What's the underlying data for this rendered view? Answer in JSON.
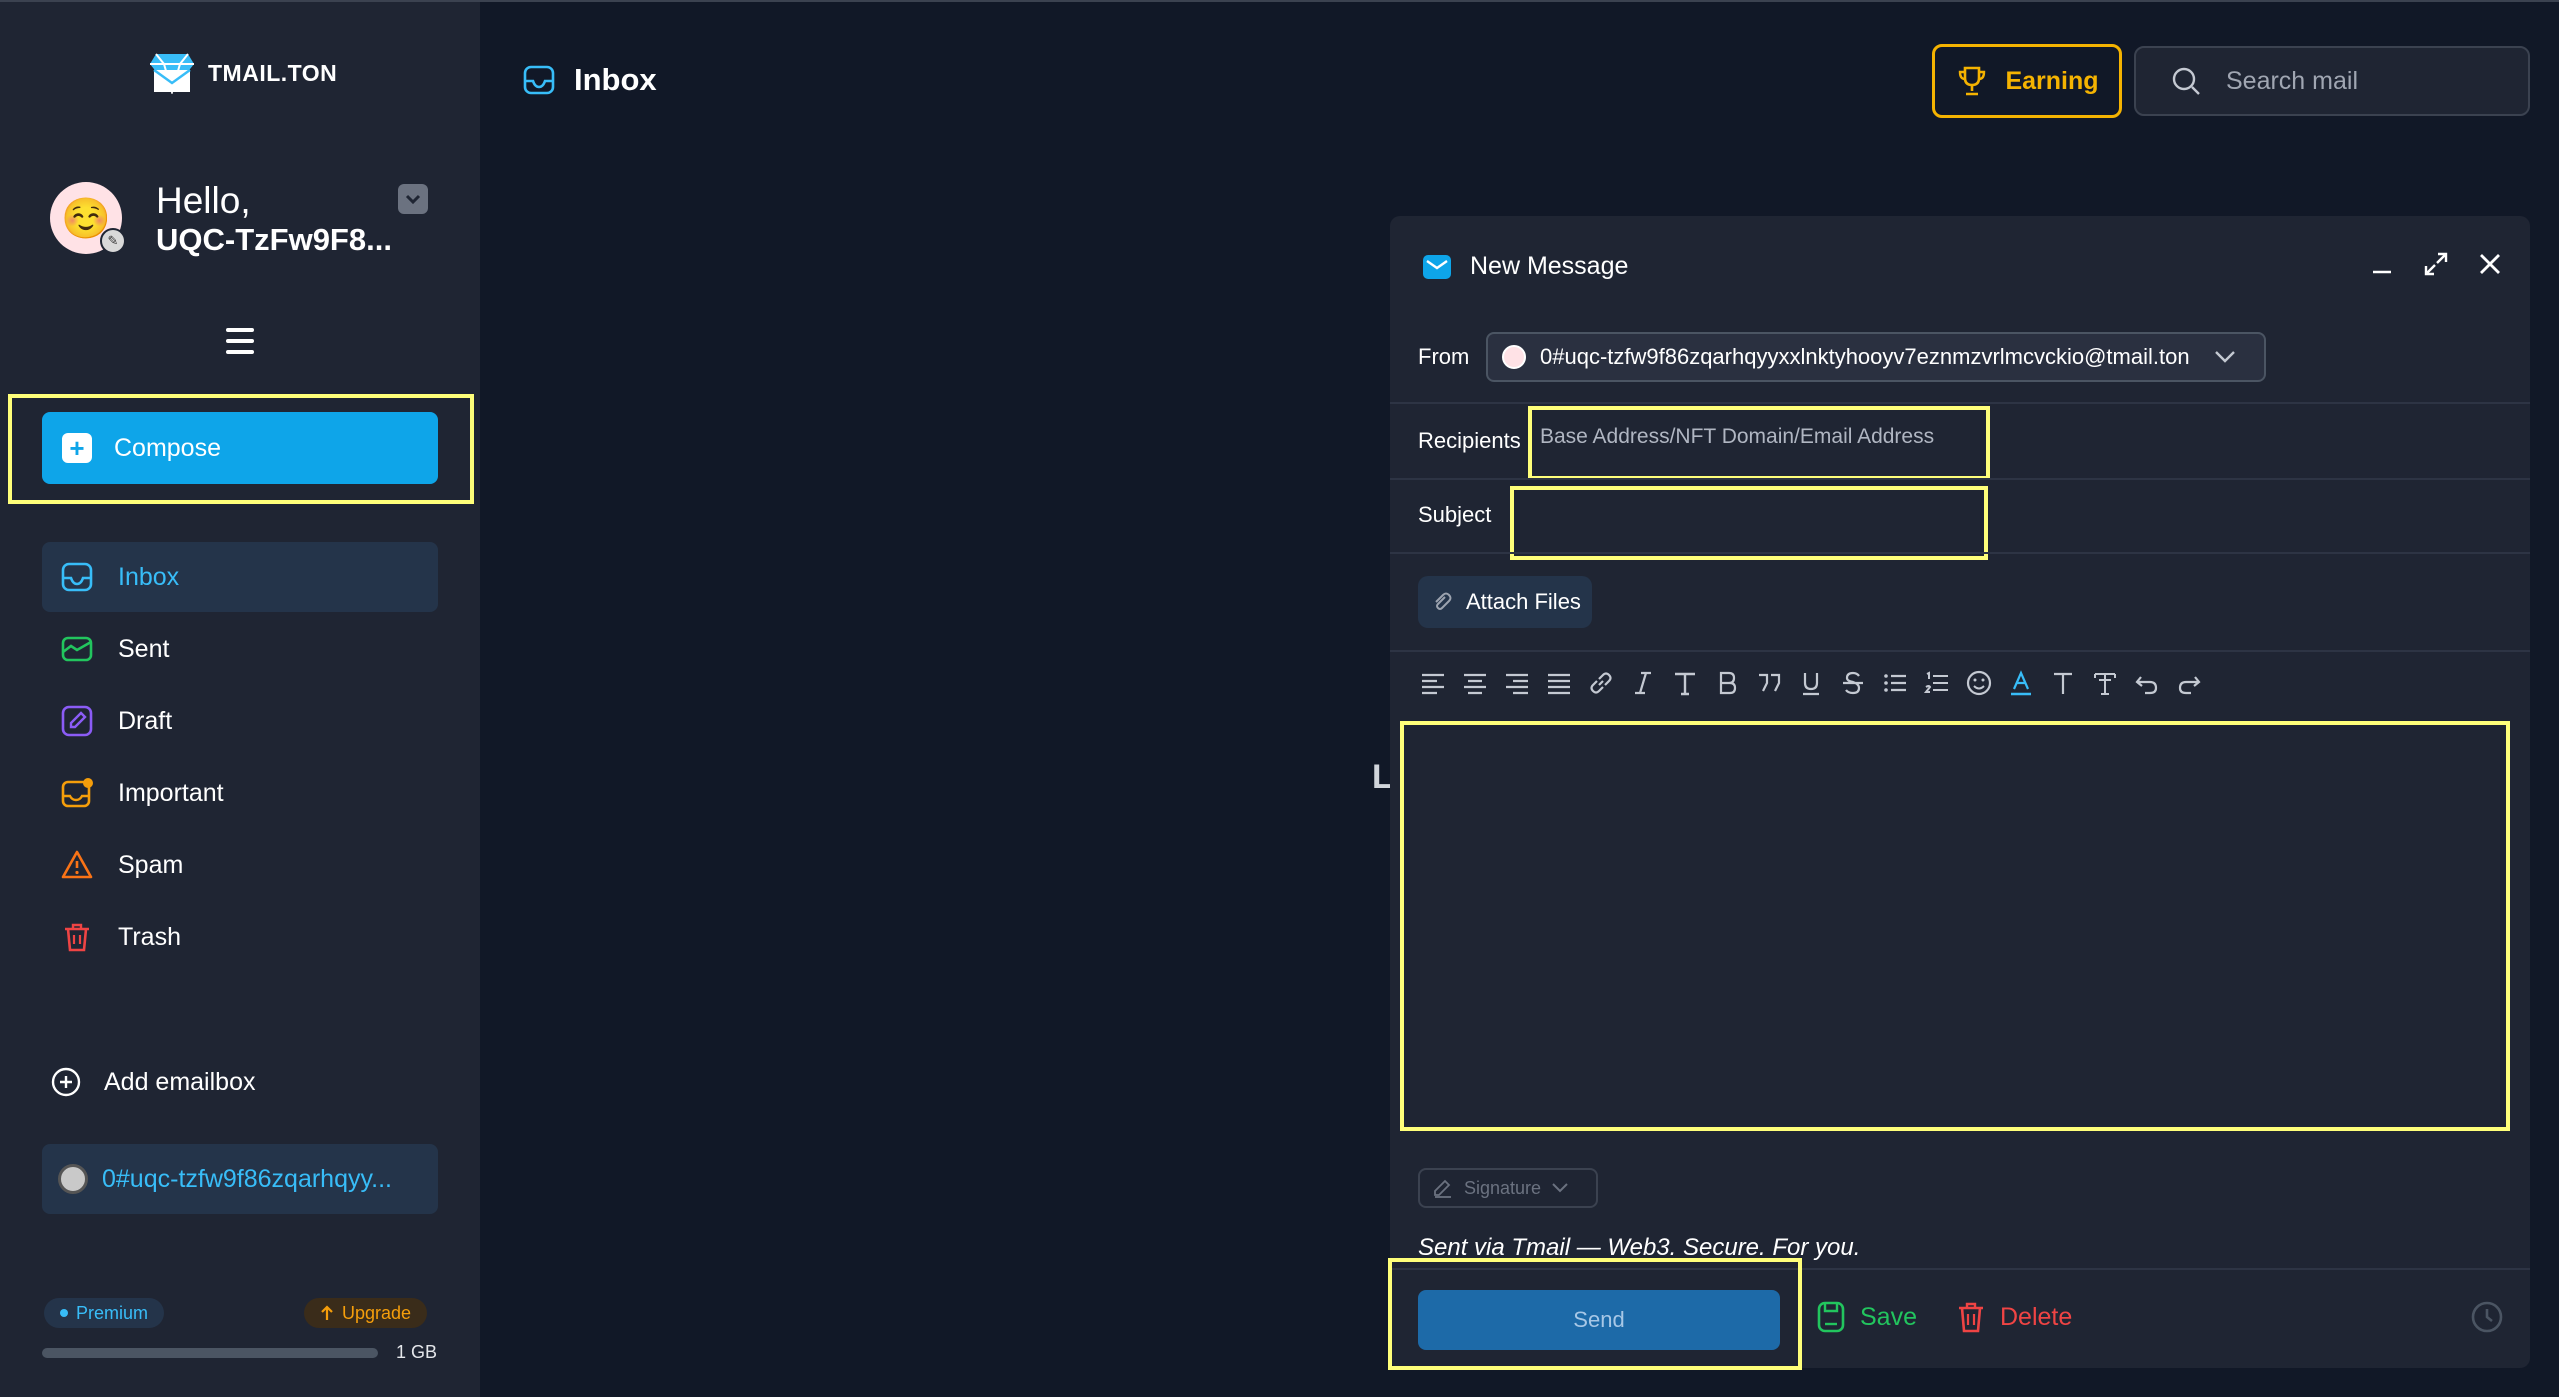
{
  "app": {
    "logo_text": "TMAIL.TON"
  },
  "user": {
    "greeting": "Hello,",
    "username": "UQC-TzFw9F8...",
    "avatar_emoji": "☺️"
  },
  "sidebar": {
    "compose_label": "Compose",
    "items": [
      {
        "label": "Inbox",
        "icon": "inbox-icon",
        "active": true
      },
      {
        "label": "Sent",
        "icon": "sent-icon",
        "active": false
      },
      {
        "label": "Draft",
        "icon": "draft-icon",
        "active": false
      },
      {
        "label": "Important",
        "icon": "important-icon",
        "active": false
      },
      {
        "label": "Spam",
        "icon": "spam-icon",
        "active": false
      },
      {
        "label": "Trash",
        "icon": "trash-icon",
        "active": false
      }
    ],
    "add_emailbox_label": "Add emailbox",
    "address_chip": "0#uqc-tzfw9f86zqarhqyy...",
    "premium_label": "Premium",
    "upgrade_label": "Upgrade",
    "storage_label": "1 GB"
  },
  "header": {
    "title": "Inbox",
    "earning_label": "Earning",
    "search_placeholder": "Search mail"
  },
  "background": {
    "stray_letter": "L"
  },
  "compose": {
    "title": "New Message",
    "from_label": "From",
    "from_value": "0#uqc-tzfw9f86zqarhqyyxxlnktyhooyv7eznmzvrlmcvckio@tmail.ton",
    "recipients_label": "Recipients",
    "recipients_placeholder": "Base Address/NFT Domain/Email Address",
    "subject_label": "Subject",
    "subject_value": "",
    "attach_label": "Attach Files",
    "signature_label": "Signature",
    "footer_text": "Sent via Tmail — Web3. Secure. For you.",
    "send_label": "Send",
    "save_label": "Save",
    "delete_label": "Delete"
  },
  "colors": {
    "accent": "#0ea5e9",
    "highlight": "#ffff7a",
    "earning": "#f5b301",
    "save": "#22c55e",
    "delete": "#ef4444"
  }
}
